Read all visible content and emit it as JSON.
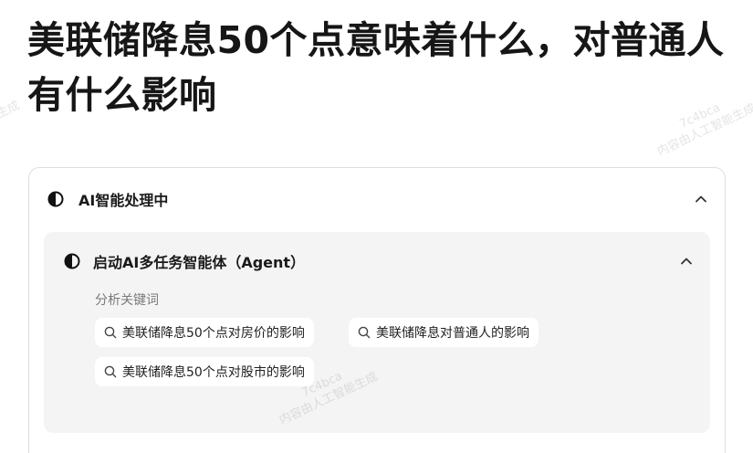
{
  "page": {
    "title": "美联储降息50个点意味着什么，对普通人有什么影响"
  },
  "card": {
    "header_label": "AI智能处理中",
    "inner": {
      "header_label": "启动AI多任务智能体（Agent）",
      "section_label": "分析关键词",
      "keywords": [
        "美联储降息50个点对房价的影响",
        "美联储降息对普通人的影响",
        "美联储降息50个点对股市的影响"
      ]
    }
  },
  "watermark": {
    "code": "7c4bca",
    "text": "内容由人工智能生成",
    "left_fragment": "生成"
  },
  "icons": {
    "status": "half-circle-icon",
    "collapse": "chevron-up-icon",
    "keyword": "search-icon"
  },
  "colors": {
    "chip_bg": "#ffffff",
    "inner_bg": "#f4f4f5",
    "border": "#dedede"
  }
}
